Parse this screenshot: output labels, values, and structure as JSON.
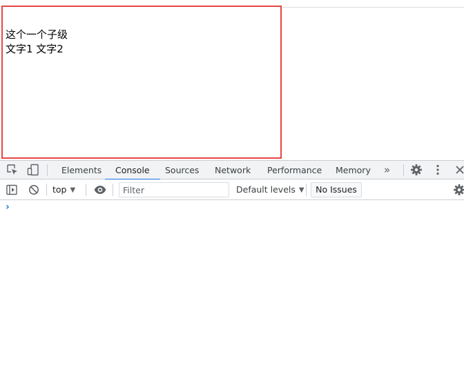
{
  "page": {
    "lines": [
      "这个一个子级",
      "文字1 文字2"
    ]
  },
  "devtools": {
    "tabs": [
      {
        "label": "Elements",
        "active": false
      },
      {
        "label": "Console",
        "active": true
      },
      {
        "label": "Sources",
        "active": false
      },
      {
        "label": "Network",
        "active": false
      },
      {
        "label": "Performance",
        "active": false
      },
      {
        "label": "Memory",
        "active": false
      }
    ],
    "more_tabs_label": "»",
    "toolbar": {
      "context": "top",
      "filter_placeholder": "Filter",
      "filter_value": "",
      "levels": "Default levels",
      "issues": "No Issues"
    },
    "prompt_symbol": "›",
    "icons": [
      "inspect-element-icon",
      "device-toolbar-icon",
      "settings-gear-icon",
      "kebab-menu-icon",
      "close-icon",
      "sidebar-toggle-icon",
      "clear-console-icon",
      "eye-icon",
      "console-settings-gear-icon"
    ],
    "colors": {
      "accent": "#1a73e8",
      "highlight_border": "#e84444",
      "tabbar_bg": "#f1f3f4"
    }
  }
}
